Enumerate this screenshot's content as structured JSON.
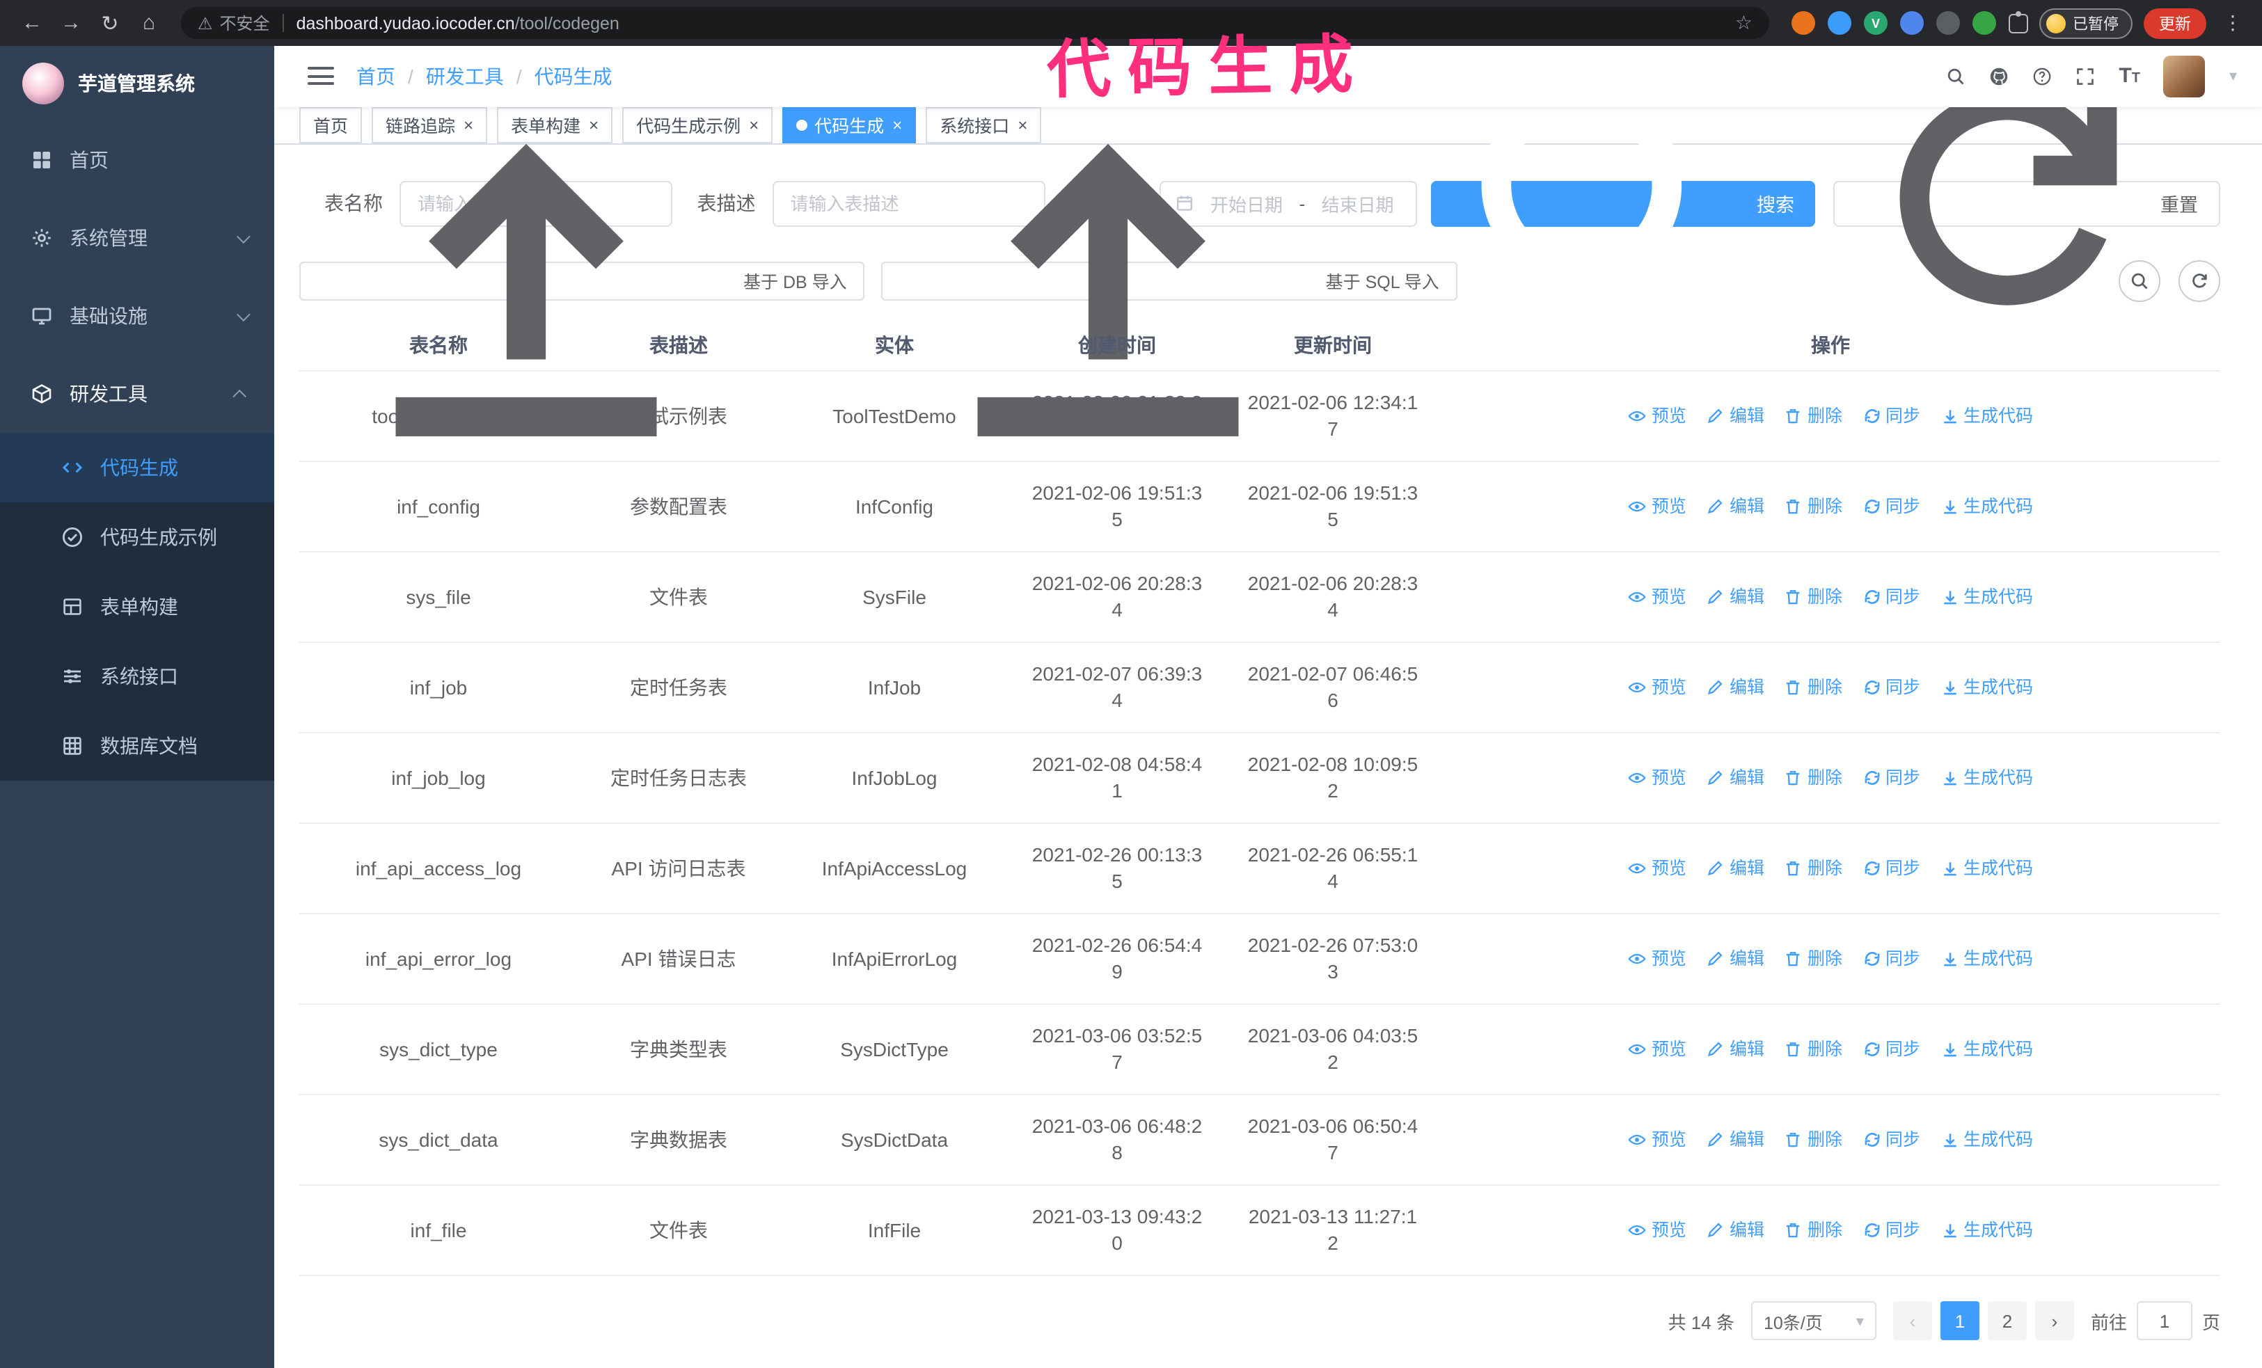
{
  "colors": {
    "accent": "#409eff",
    "sidebar_bg": "#304156",
    "submenu_bg": "#1f2d3d",
    "chrome_bg": "#26282b",
    "update_red": "#d93a2b",
    "annotation_pink": "#ff2f7e"
  },
  "glyphs": {
    "back": "←",
    "forward": "→",
    "reload": "↻",
    "home": "⌂",
    "warning": "⚠",
    "star": "☆",
    "more": "⋮",
    "caret": "▾",
    "close": "×",
    "prev": "‹",
    "next": "›",
    "font_big": "T",
    "font_small": "T",
    "vue_ext_label": "V"
  },
  "browser": {
    "security_label": "不安全",
    "url_host": "dashboard.yudao.iocoder.cn",
    "url_path": "/tool/codegen",
    "paused_label": "已暂停",
    "update_label": "更新"
  },
  "annotation": {
    "text": "代码生成"
  },
  "sidebar": {
    "logo_title": "芋道管理系统",
    "items": [
      {
        "label": "首页"
      },
      {
        "label": "系统管理"
      },
      {
        "label": "基础设施"
      },
      {
        "label": "研发工具"
      }
    ],
    "subitems": [
      {
        "label": "代码生成"
      },
      {
        "label": "代码生成示例"
      },
      {
        "label": "表单构建"
      },
      {
        "label": "系统接口"
      },
      {
        "label": "数据库文档"
      }
    ]
  },
  "header": {
    "breadcrumb": [
      "首页",
      "研发工具",
      "代码生成"
    ]
  },
  "tabs": [
    {
      "label": "首页"
    },
    {
      "label": "链路追踪"
    },
    {
      "label": "表单构建"
    },
    {
      "label": "代码生成示例"
    },
    {
      "label": "代码生成"
    },
    {
      "label": "系统接口"
    }
  ],
  "filters": {
    "name_label": "表名称",
    "name_placeholder": "请输入表名称",
    "desc_label": "表描述",
    "desc_placeholder": "请输入表描述",
    "time_label": "创建时间",
    "start_placeholder": "开始日期",
    "range_separator": "-",
    "end_placeholder": "结束日期",
    "search_label": "搜索",
    "reset_label": "重置"
  },
  "toolbar": {
    "import_db": "基于 DB 导入",
    "import_sql": "基于 SQL 导入"
  },
  "table": {
    "columns": [
      "表名称",
      "表描述",
      "实体",
      "创建时间",
      "更新时间",
      "操作"
    ],
    "op_labels": [
      "预览",
      "编辑",
      "删除",
      "同步",
      "生成代码"
    ],
    "rows": [
      {
        "name": "tool_test_demo",
        "desc": "测试示例表",
        "entity": "ToolTestDemo",
        "created": "2021-02-06 01:33:25",
        "updated": "2021-02-06 12:34:17"
      },
      {
        "name": "inf_config",
        "desc": "参数配置表",
        "entity": "InfConfig",
        "created": "2021-02-06 19:51:35",
        "updated": "2021-02-06 19:51:35"
      },
      {
        "name": "sys_file",
        "desc": "文件表",
        "entity": "SysFile",
        "created": "2021-02-06 20:28:34",
        "updated": "2021-02-06 20:28:34"
      },
      {
        "name": "inf_job",
        "desc": "定时任务表",
        "entity": "InfJob",
        "created": "2021-02-07 06:39:34",
        "updated": "2021-02-07 06:46:56"
      },
      {
        "name": "inf_job_log",
        "desc": "定时任务日志表",
        "entity": "InfJobLog",
        "created": "2021-02-08 04:58:41",
        "updated": "2021-02-08 10:09:52"
      },
      {
        "name": "inf_api_access_log",
        "desc": "API 访问日志表",
        "entity": "InfApiAccessLog",
        "created": "2021-02-26 00:13:35",
        "updated": "2021-02-26 06:55:14"
      },
      {
        "name": "inf_api_error_log",
        "desc": "API 错误日志",
        "entity": "InfApiErrorLog",
        "created": "2021-02-26 06:54:49",
        "updated": "2021-02-26 07:53:03"
      },
      {
        "name": "sys_dict_type",
        "desc": "字典类型表",
        "entity": "SysDictType",
        "created": "2021-03-06 03:52:57",
        "updated": "2021-03-06 04:03:52"
      },
      {
        "name": "sys_dict_data",
        "desc": "字典数据表",
        "entity": "SysDictData",
        "created": "2021-03-06 06:48:28",
        "updated": "2021-03-06 06:50:47"
      },
      {
        "name": "inf_file",
        "desc": "文件表",
        "entity": "InfFile",
        "created": "2021-03-13 09:43:20",
        "updated": "2021-03-13 11:27:12"
      }
    ]
  },
  "pagination": {
    "total": "共 14 条",
    "page_size": "10条/页",
    "pages": [
      "1",
      "2"
    ],
    "goto_label": "前往",
    "goto_value": "1",
    "page_suffix": "页"
  }
}
